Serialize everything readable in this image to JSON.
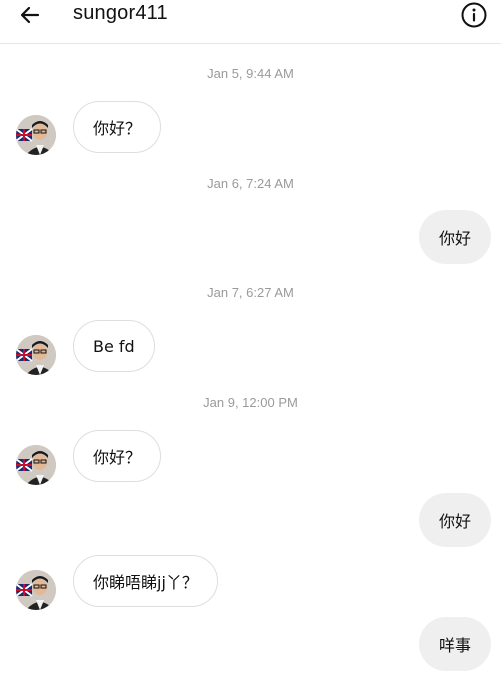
{
  "header": {
    "username": "sungor411",
    "back_icon": "arrow-left-icon",
    "info_icon": "info-circle-icon"
  },
  "messages": [
    {
      "type": "timestamp",
      "text": "Jan 5, 9:44 AM"
    },
    {
      "type": "incoming",
      "text": "你好？"
    },
    {
      "type": "timestamp",
      "text": "Jan 6, 7:24 AM"
    },
    {
      "type": "outgoing",
      "text": "你好"
    },
    {
      "type": "timestamp",
      "text": "Jan 7, 6:27 AM"
    },
    {
      "type": "incoming",
      "text": "Be fd"
    },
    {
      "type": "timestamp",
      "text": "Jan 9, 12:00 PM"
    },
    {
      "type": "incoming",
      "text": "你好？"
    },
    {
      "type": "outgoing",
      "text": "你好"
    },
    {
      "type": "incoming",
      "text": "你睇唔睇jj丫？"
    },
    {
      "type": "outgoing",
      "text": "咩事"
    }
  ],
  "colors": {
    "incoming_bubble_border": "#dedede",
    "outgoing_bubble_bg": "#efefef",
    "timestamp_text": "#9a9a9a"
  }
}
